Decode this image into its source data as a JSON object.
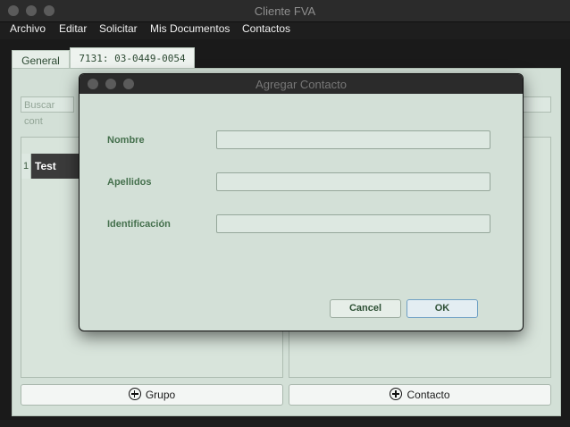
{
  "window": {
    "title": "Cliente FVA"
  },
  "menu": [
    "Archivo",
    "Editar",
    "Solicitar",
    "Mis Documentos",
    "Contactos"
  ],
  "tabs": [
    {
      "label": "General"
    },
    {
      "label": "7131: 03-0449-0054"
    }
  ],
  "search": {
    "placeholder": "Buscar cont"
  },
  "groups": [
    {
      "index": "1",
      "name": "Test"
    }
  ],
  "buttons": {
    "group": "Grupo",
    "contact": "Contacto"
  },
  "dialog": {
    "title": "Agregar Contacto",
    "fields": [
      {
        "label": "Nombre",
        "value": ""
      },
      {
        "label": "Apellidos",
        "value": ""
      },
      {
        "label": "Identificación",
        "value": ""
      }
    ],
    "cancel": "Cancel",
    "ok": "OK"
  },
  "colors": {
    "panel": "#d3e0d7",
    "accent_text": "#45704d",
    "ok_border": "#6fa0c4"
  }
}
